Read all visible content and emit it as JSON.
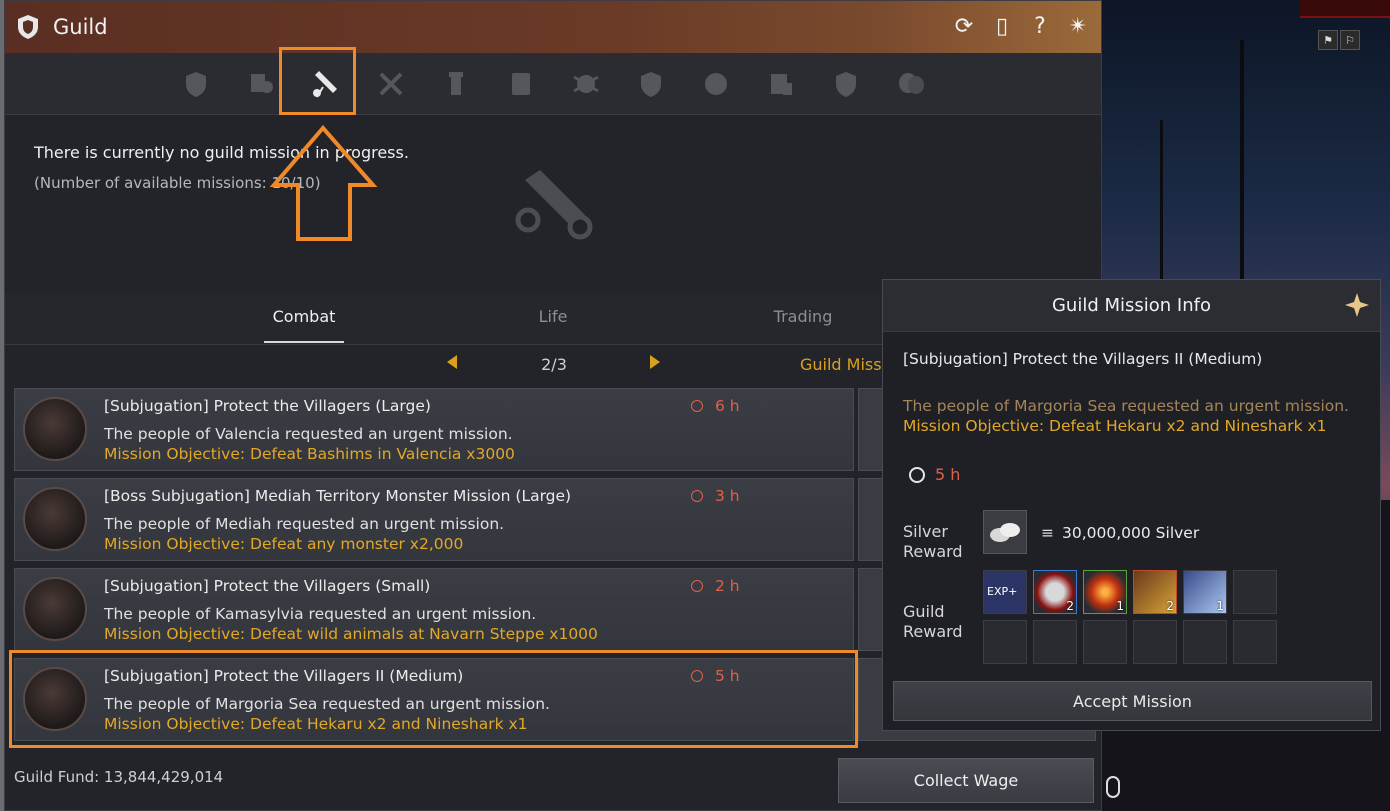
{
  "window": {
    "title": "Guild"
  },
  "status": {
    "message": "There is currently no guild mission in progress.",
    "available": "(Number of available missions: 10/10)"
  },
  "categories": [
    {
      "label": "Combat",
      "active": true
    },
    {
      "label": "Life",
      "active": false
    },
    {
      "label": "Trading",
      "active": false
    }
  ],
  "pager": {
    "page": "2/3",
    "guild_mission_label": "Guild Missi"
  },
  "missions": [
    {
      "title": "[Subjugation] Protect the Villagers (Large)",
      "desc": "The people of Valencia requested an urgent mission.",
      "objective": "Mission Objective: Defeat Bashims in Valencia x3000",
      "time": "6 h"
    },
    {
      "title": "[Boss Subjugation] Mediah Territory Monster Mission (Large)",
      "desc": "The people of Mediah requested an urgent mission.",
      "objective": "Mission Objective: Defeat any monster x2,000",
      "time": "3 h"
    },
    {
      "title": "[Subjugation] Protect the Villagers (Small)",
      "desc": "The people of Kamasylvia requested an urgent mission.",
      "objective": "Mission Objective: Defeat wild animals at Navarn Steppe x1000",
      "time": "2 h"
    },
    {
      "title": "[Subjugation] Protect the Villagers II (Medium)",
      "desc": "The people of Margoria Sea requested an urgent mission.",
      "objective": "Mission Objective: Defeat Hekaru x2 and Nineshark x1",
      "time": "5 h"
    }
  ],
  "footer": {
    "fund": "Guild Fund: 13,844,429,014",
    "collect_label": "Collect Wage"
  },
  "info": {
    "header": "Guild Mission Info",
    "title": "[Subjugation] Protect the Villagers II (Medium)",
    "desc": "The people of Margoria Sea requested an urgent mission.",
    "objective": "Mission Objective: Defeat Hekaru x2 and Nineshark x1",
    "time": "5 h",
    "silver_label": "Silver\nReward",
    "silver_value": "30,000,000 Silver",
    "guild_label": "Guild\nReward",
    "reward_counts": [
      "",
      "2",
      "1",
      "2",
      "1"
    ],
    "accept_label": "Accept Mission"
  },
  "tab_icons": [
    "guild-crest-icon",
    "member-list-icon",
    "mission-scroll-icon",
    "crossed-weapons-icon",
    "tower-icon",
    "notice-board-icon",
    "war-icon",
    "shield-icon",
    "emblem-icon",
    "bulletin-icon",
    "fleur-shield-icon",
    "masks-icon"
  ],
  "colors": {
    "accent_orange": "#f08a28",
    "objective_gold": "#e2a826",
    "time_red": "#e0604a"
  }
}
